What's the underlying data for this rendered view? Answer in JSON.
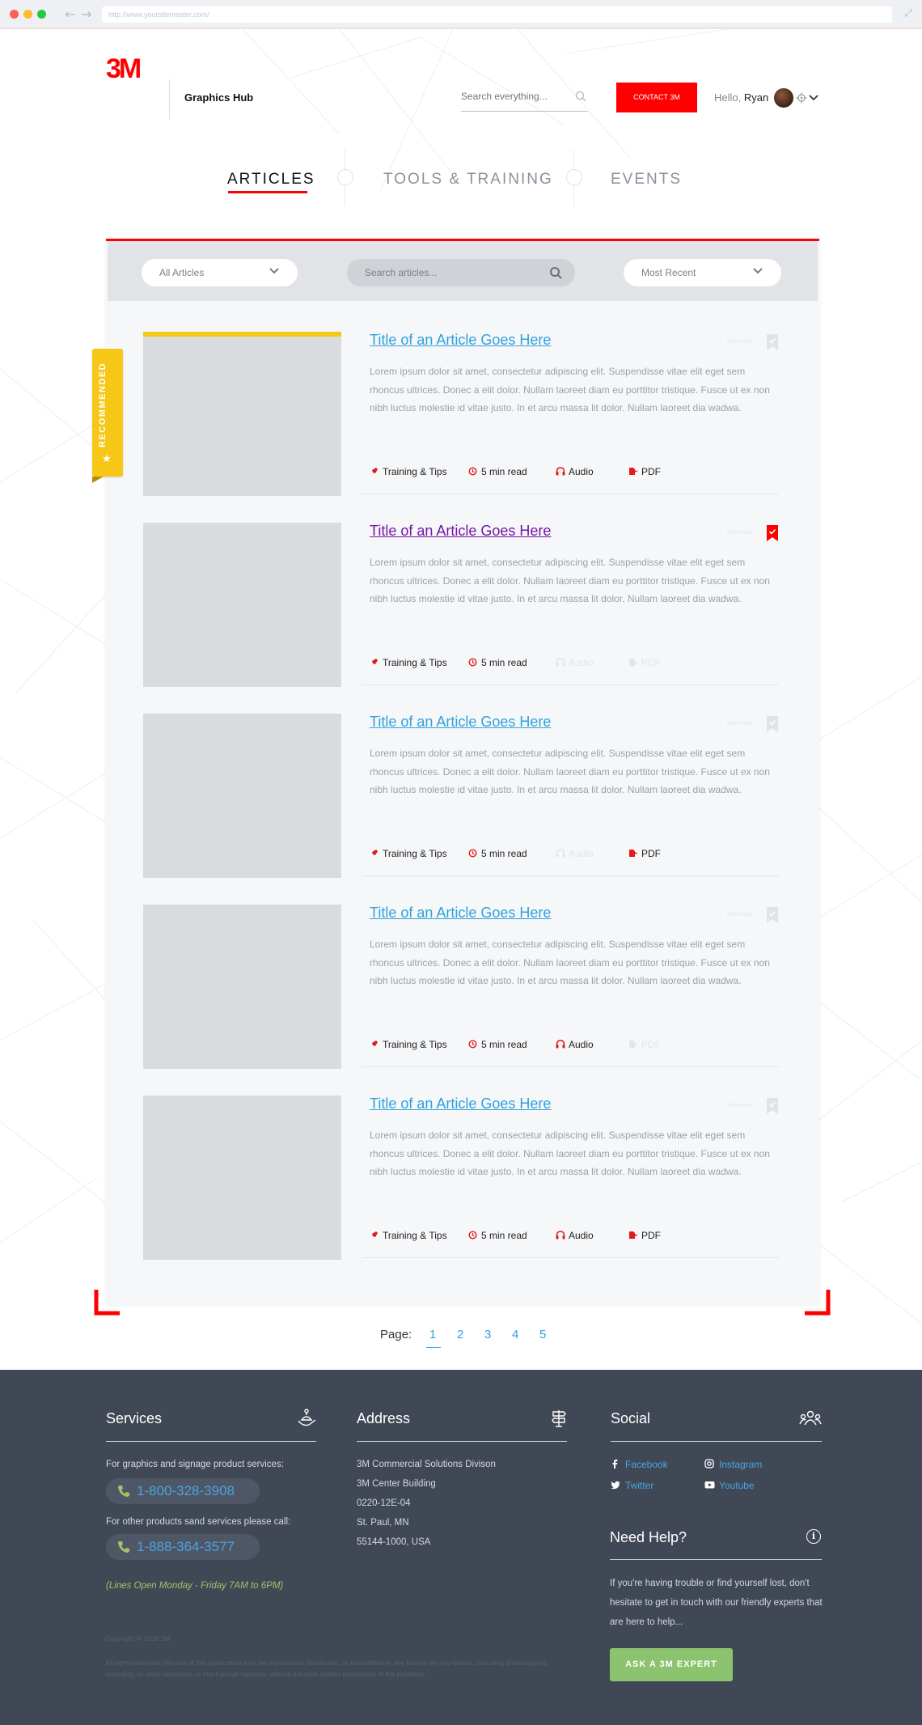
{
  "browser": {
    "url": "http://www.yoursitemaster.com/"
  },
  "header": {
    "brand": "3M",
    "site_name": "Graphics Hub",
    "search_placeholder": "Search everything...",
    "contact_label": "CONTACT 3M",
    "greeting": "Hello,",
    "user_name": "Ryan"
  },
  "nav": {
    "tabs": [
      {
        "label": "ARTICLES",
        "active": true
      },
      {
        "label": "TOOLS & TRAINING",
        "active": false
      },
      {
        "label": "EVENTS",
        "active": false
      }
    ]
  },
  "filters": {
    "category": "All Articles",
    "search_placeholder": "Search articles...",
    "sort": "Most Recent"
  },
  "ribbon": {
    "label": "RECOMMENDED"
  },
  "articles": [
    {
      "title": "Title of an Article Goes Here",
      "excerpt": "Lorem ipsum dolor sit amet, consectetur adipiscing elit. Suspendisse vitae elit eget sem rhoncus ultrices. Donec a elit dolor. Nullam laoreet diam eu porttitor tristique. Fusce ut ex non nibh luctus molestie id vitae justo. In et arcu massa lit dolor. Nullam laoreet dia wadwa.",
      "bookmark_label": "Bookmark",
      "bookmarked": false,
      "visited": false,
      "recommended": true,
      "category": "Training & Tips",
      "read_time": "5 min read",
      "audio": "Audio",
      "pdf": "PDF",
      "has_audio": true,
      "has_pdf": true
    },
    {
      "title": "Title of an Article Goes Here",
      "excerpt": "Lorem ipsum dolor sit amet, consectetur adipiscing elit. Suspendisse vitae elit eget sem rhoncus ultrices. Donec a elit dolor. Nullam laoreet diam eu porttitor tristique. Fusce ut ex non nibh luctus molestie id vitae justo. In et arcu massa lit dolor. Nullam laoreet dia wadwa.",
      "bookmark_label": "Bookmark",
      "bookmarked": true,
      "visited": true,
      "recommended": false,
      "category": "Training & Tips",
      "read_time": "5 min read",
      "audio": "Audio",
      "pdf": "PDF",
      "has_audio": false,
      "has_pdf": false
    },
    {
      "title": "Title of an Article Goes Here",
      "excerpt": "Lorem ipsum dolor sit amet, consectetur adipiscing elit. Suspendisse vitae elit eget sem rhoncus ultrices. Donec a elit dolor. Nullam laoreet diam eu porttitor tristique. Fusce ut ex non nibh luctus molestie id vitae justo. In et arcu massa lit dolor. Nullam laoreet dia wadwa.",
      "bookmark_label": "Bookmark",
      "bookmarked": false,
      "visited": false,
      "recommended": false,
      "category": "Training & Tips",
      "read_time": "5 min read",
      "audio": "Audio",
      "pdf": "PDF",
      "has_audio": false,
      "has_pdf": true
    },
    {
      "title": "Title of an Article Goes Here",
      "excerpt": "Lorem ipsum dolor sit amet, consectetur adipiscing elit. Suspendisse vitae elit eget sem rhoncus ultrices. Donec a elit dolor. Nullam laoreet diam eu porttitor tristique. Fusce ut ex non nibh luctus molestie id vitae justo. In et arcu massa lit dolor. Nullam laoreet dia wadwa.",
      "bookmark_label": "Bookmark",
      "bookmarked": false,
      "visited": false,
      "recommended": false,
      "category": "Training & Tips",
      "read_time": "5 min read",
      "audio": "Audio",
      "pdf": "PDF",
      "has_audio": true,
      "has_pdf": false
    },
    {
      "title": "Title of an Article Goes Here",
      "excerpt": "Lorem ipsum dolor sit amet, consectetur adipiscing elit. Suspendisse vitae elit eget sem rhoncus ultrices. Donec a elit dolor. Nullam laoreet diam eu porttitor tristique. Fusce ut ex non nibh luctus molestie id vitae justo. In et arcu massa lit dolor. Nullam laoreet dia wadwa.",
      "bookmark_label": "Bookmark",
      "bookmarked": false,
      "visited": false,
      "recommended": false,
      "category": "Training & Tips",
      "read_time": "5 min read",
      "audio": "Audio",
      "pdf": "PDF",
      "has_audio": true,
      "has_pdf": true
    }
  ],
  "pagination": {
    "label": "Page:",
    "pages": [
      "1",
      "2",
      "3",
      "4",
      "5"
    ],
    "current": "1"
  },
  "footer": {
    "services": {
      "heading": "Services",
      "line1": "For graphics and signage product services:",
      "phone1": "1-800-328-3908",
      "line2": "For other products sand services please call:",
      "phone2": "1-888-364-3577",
      "hours": "(Lines Open Monday - Friday 7AM to 6PM)"
    },
    "address": {
      "heading": "Address",
      "lines": [
        "3M Commercial Solutions Divison",
        "3M Center Building",
        "0220-12E-04",
        "St. Paul, MN",
        "55144-1000, USA"
      ]
    },
    "social": {
      "heading": "Social",
      "links": [
        "Facebook",
        "Instagram",
        "Twitter",
        "Youtube"
      ]
    },
    "help": {
      "heading": "Need Help?",
      "text": "If you're having trouble or find yourself lost, don't hesitate to get in touch with our friendly experts that are here to help...",
      "button": "ASK A 3M EXPERT"
    },
    "copyright": "Copyright © 2018 3M",
    "rights": "All rights reserved. No part of this publication may be reproduced, distributed, or transmitted in any form or by any means, including photocopying, recording, or other electronic or mechanical methods, without the prior written permission of the publisher."
  },
  "colors": {
    "brand_red": "#ff0000",
    "link_blue": "#2ea2dc",
    "visited_purple": "#7417a6",
    "ribbon_yellow": "#f6c716",
    "footer_bg": "#414855",
    "button_green": "#8cc36e"
  }
}
